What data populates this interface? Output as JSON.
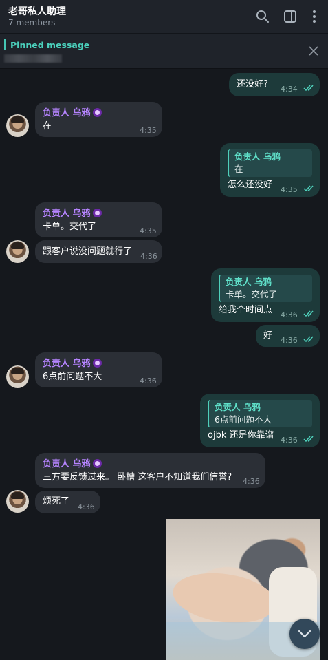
{
  "header": {
    "title": "老哥私人助理",
    "members": "7 members",
    "icons": [
      "search-icon",
      "sidebar-toggle-icon",
      "more-vertical-icon"
    ]
  },
  "pinned": {
    "label": "Pinned message",
    "icons": [
      "close-icon"
    ]
  },
  "messages": [
    {
      "dir": "out",
      "text": "还没好?",
      "time": "4:34"
    },
    {
      "dir": "in",
      "sender": "负责人 乌鸦",
      "text": "在",
      "time": "4:35"
    },
    {
      "dir": "out",
      "reply_name": "负责人 乌鸦",
      "reply_text": "在",
      "text": "怎么还没好",
      "time": "4:35"
    },
    {
      "dir": "in",
      "sender": "负责人 乌鸦",
      "text": "卡单。交代了",
      "time": "4:35"
    },
    {
      "dir": "in",
      "text": "跟客户说没问题就行了",
      "time": "4:36"
    },
    {
      "dir": "out",
      "reply_name": "负责人 乌鸦",
      "reply_text": "卡单。交代了",
      "text": "给我个时间点",
      "time": "4:36"
    },
    {
      "dir": "out",
      "text": "好",
      "time": "4:36"
    },
    {
      "dir": "in",
      "sender": "负责人 乌鸦",
      "text": "6点前问题不大",
      "time": "4:36"
    },
    {
      "dir": "out",
      "reply_name": "负责人 乌鸦",
      "reply_text": "6点前问题不大",
      "text": "ojbk 还是你靠谱",
      "time": "4:36"
    },
    {
      "dir": "in",
      "sender": "负责人 乌鸦",
      "text": "三方要反馈过来。 卧槽 这客户不知道我们信誉?",
      "time": "4:36"
    },
    {
      "dir": "in",
      "text": "烦死了",
      "time": "4:36"
    }
  ],
  "colors": {
    "background": "#15181d",
    "incoming_bubble": "#2b2f36",
    "outgoing_bubble": "#1d3a3a",
    "sender_name": "#b684ff",
    "accent_teal": "#4bd1bd",
    "read_check": "#4fd0bb"
  }
}
